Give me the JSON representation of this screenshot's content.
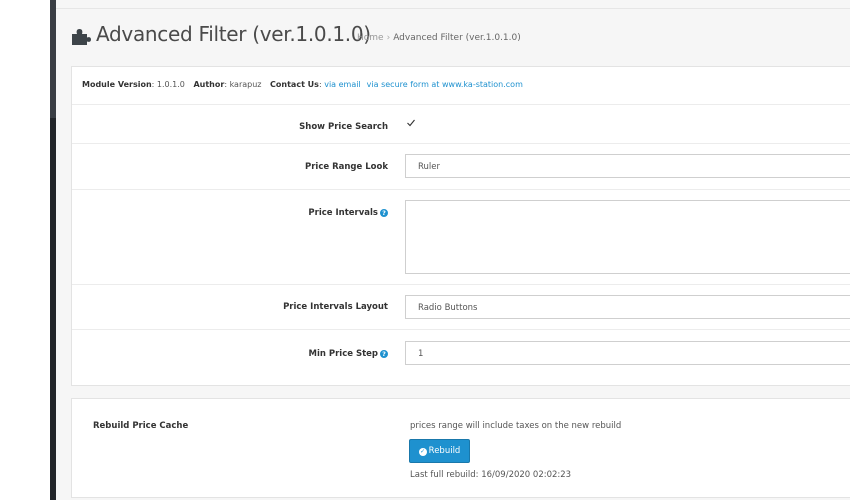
{
  "header": {
    "title": "Advanced Filter (ver.1.0.1.0)",
    "breadcrumb": {
      "home": "Home",
      "separator": "›",
      "current": "Advanced Filter (ver.1.0.1.0)"
    },
    "icon": "puzzle-icon"
  },
  "info": {
    "module_version_label": "Module Version",
    "module_version_value": "1.0.1.0",
    "author_label": "Author",
    "author_value": "karapuz",
    "contact_label": "Contact Us",
    "contact_email_link": "via email",
    "contact_form_link": "via secure form at www.ka-station.com"
  },
  "settings": {
    "show_price_search": {
      "label": "Show Price Search",
      "checked": true
    },
    "price_range_look": {
      "label": "Price Range Look",
      "value": "Ruler"
    },
    "price_intervals": {
      "label": "Price Intervals",
      "value": ""
    },
    "price_intervals_layout": {
      "label": "Price Intervals Layout",
      "value": "Radio Buttons"
    },
    "min_price_step": {
      "label": "Min Price Step",
      "value": "1"
    }
  },
  "rebuild": {
    "label": "Rebuild Price Cache",
    "note": "prices range will include taxes on the new rebuild",
    "button_label": "Rebuild",
    "last_rebuild": "Last full rebuild: 16/09/2020 02:02:23"
  },
  "colors": {
    "accent": "#1e91cf",
    "sidebar": "#222529",
    "background": "#f6f6f6"
  }
}
